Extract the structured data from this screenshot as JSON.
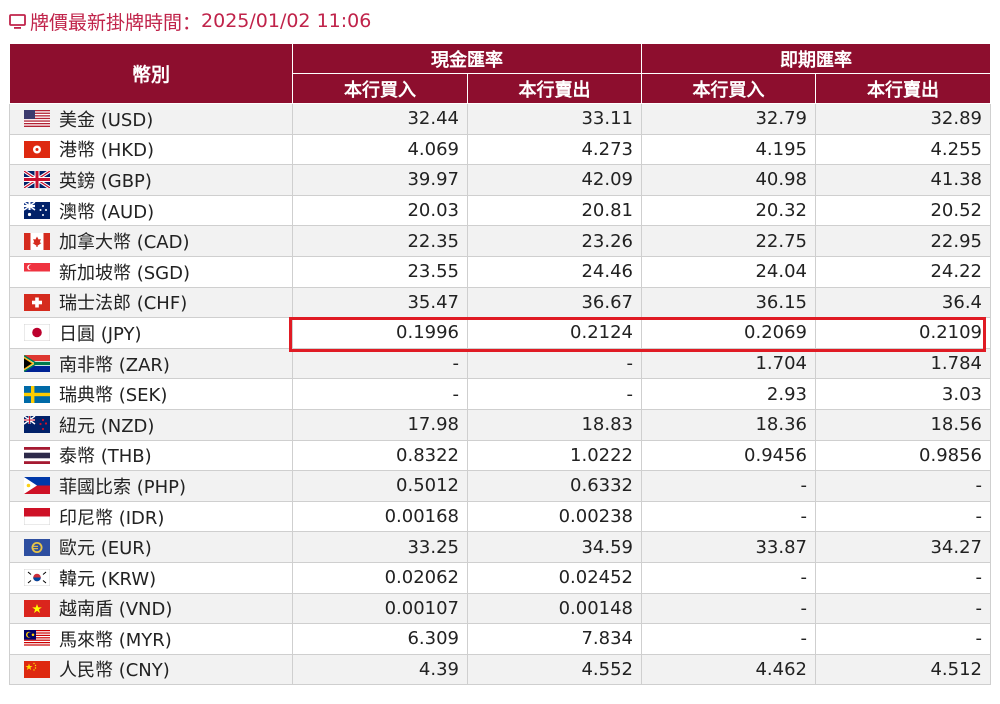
{
  "updated": {
    "label": "牌價最新掛牌時間：",
    "time": "2025/01/02 11:06"
  },
  "header": {
    "currency": "幣別",
    "cash": "現金匯率",
    "spot": "即期匯率",
    "buy": "本行買入",
    "sell": "本行賣出"
  },
  "rates": [
    {
      "flag": "flag-us-icon",
      "name": "美金 (USD)",
      "cash_buy": "32.44",
      "cash_sell": "33.11",
      "spot_buy": "32.79",
      "spot_sell": "32.89"
    },
    {
      "flag": "flag-hk-icon",
      "name": "港幣 (HKD)",
      "cash_buy": "4.069",
      "cash_sell": "4.273",
      "spot_buy": "4.195",
      "spot_sell": "4.255"
    },
    {
      "flag": "flag-gb-icon",
      "name": "英鎊 (GBP)",
      "cash_buy": "39.97",
      "cash_sell": "42.09",
      "spot_buy": "40.98",
      "spot_sell": "41.38"
    },
    {
      "flag": "flag-au-icon",
      "name": "澳幣 (AUD)",
      "cash_buy": "20.03",
      "cash_sell": "20.81",
      "spot_buy": "20.32",
      "spot_sell": "20.52"
    },
    {
      "flag": "flag-ca-icon",
      "name": "加拿大幣 (CAD)",
      "cash_buy": "22.35",
      "cash_sell": "23.26",
      "spot_buy": "22.75",
      "spot_sell": "22.95"
    },
    {
      "flag": "flag-sg-icon",
      "name": "新加坡幣 (SGD)",
      "cash_buy": "23.55",
      "cash_sell": "24.46",
      "spot_buy": "24.04",
      "spot_sell": "24.22"
    },
    {
      "flag": "flag-ch-icon",
      "name": "瑞士法郎 (CHF)",
      "cash_buy": "35.47",
      "cash_sell": "36.67",
      "spot_buy": "36.15",
      "spot_sell": "36.4"
    },
    {
      "flag": "flag-jp-icon",
      "name": "日圓 (JPY)",
      "cash_buy": "0.1996",
      "cash_sell": "0.2124",
      "spot_buy": "0.2069",
      "spot_sell": "0.2109"
    },
    {
      "flag": "flag-za-icon",
      "name": "南非幣 (ZAR)",
      "cash_buy": "-",
      "cash_sell": "-",
      "spot_buy": "1.704",
      "spot_sell": "1.784"
    },
    {
      "flag": "flag-se-icon",
      "name": "瑞典幣 (SEK)",
      "cash_buy": "-",
      "cash_sell": "-",
      "spot_buy": "2.93",
      "spot_sell": "3.03"
    },
    {
      "flag": "flag-nz-icon",
      "name": "紐元 (NZD)",
      "cash_buy": "17.98",
      "cash_sell": "18.83",
      "spot_buy": "18.36",
      "spot_sell": "18.56"
    },
    {
      "flag": "flag-th-icon",
      "name": "泰幣 (THB)",
      "cash_buy": "0.8322",
      "cash_sell": "1.0222",
      "spot_buy": "0.9456",
      "spot_sell": "0.9856"
    },
    {
      "flag": "flag-ph-icon",
      "name": "菲國比索 (PHP)",
      "cash_buy": "0.5012",
      "cash_sell": "0.6332",
      "spot_buy": "-",
      "spot_sell": "-"
    },
    {
      "flag": "flag-id-icon",
      "name": "印尼幣 (IDR)",
      "cash_buy": "0.00168",
      "cash_sell": "0.00238",
      "spot_buy": "-",
      "spot_sell": "-"
    },
    {
      "flag": "flag-eu-icon",
      "name": "歐元 (EUR)",
      "cash_buy": "33.25",
      "cash_sell": "34.59",
      "spot_buy": "33.87",
      "spot_sell": "34.27"
    },
    {
      "flag": "flag-kr-icon",
      "name": "韓元 (KRW)",
      "cash_buy": "0.02062",
      "cash_sell": "0.02452",
      "spot_buy": "-",
      "spot_sell": "-"
    },
    {
      "flag": "flag-vn-icon",
      "name": "越南盾 (VND)",
      "cash_buy": "0.00107",
      "cash_sell": "0.00148",
      "spot_buy": "-",
      "spot_sell": "-"
    },
    {
      "flag": "flag-my-icon",
      "name": "馬來幣 (MYR)",
      "cash_buy": "6.309",
      "cash_sell": "7.834",
      "spot_buy": "-",
      "spot_sell": "-"
    },
    {
      "flag": "flag-cn-icon",
      "name": "人民幣 (CNY)",
      "cash_buy": "4.39",
      "cash_sell": "4.552",
      "spot_buy": "4.462",
      "spot_sell": "4.512"
    }
  ],
  "highlighted_row": "日圓 (JPY)",
  "colors": {
    "header_bg": "#8d0e2e",
    "title_text": "#c0234a",
    "highlight_border": "#e01b24"
  }
}
